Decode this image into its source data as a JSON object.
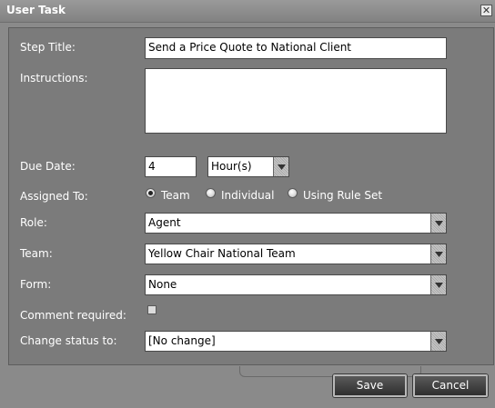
{
  "window": {
    "title": "User Task"
  },
  "form": {
    "step_title": {
      "label": "Step Title:",
      "value": "Send a Price Quote to National Client"
    },
    "instructions": {
      "label": "Instructions:",
      "value": ""
    },
    "due_date": {
      "label": "Due Date:",
      "value": "4",
      "unit": "Hour(s)"
    },
    "assigned_to": {
      "label": "Assigned To:",
      "options": [
        "Team",
        "Individual",
        "Using Rule Set"
      ],
      "selected": "Team"
    },
    "role": {
      "label": "Role:",
      "value": "Agent"
    },
    "team": {
      "label": "Team:",
      "value": "Yellow Chair National Team"
    },
    "form_field": {
      "label": "Form:",
      "value": "None"
    },
    "comment_required": {
      "label": "Comment required:",
      "checked": false
    },
    "change_status": {
      "label": "Change status to:",
      "value": "[No change]"
    }
  },
  "buttons": {
    "save": "Save",
    "cancel": "Cancel"
  }
}
